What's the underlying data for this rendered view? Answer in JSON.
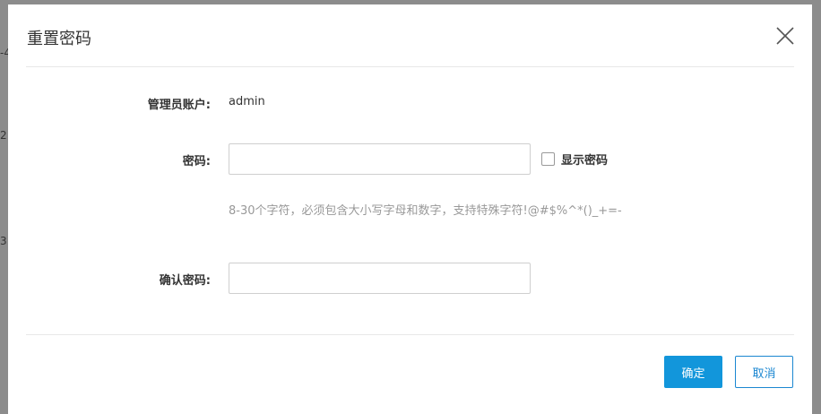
{
  "backdrop": {
    "fragments": [
      "-4",
      "2",
      "3"
    ]
  },
  "dialog": {
    "title": "重置密码",
    "close_icon": "close-icon"
  },
  "form": {
    "account_label": "管理员账户:",
    "account_value": "admin",
    "password_label": "密码:",
    "password_value": "",
    "show_password_label": "显示密码",
    "show_password_checked": false,
    "password_hint": "8-30个字符，必须包含大小写字母和数字，支持特殊字符!@#$%^*()_+=-",
    "confirm_label": "确认密码:",
    "confirm_value": ""
  },
  "footer": {
    "confirm_button": "确定",
    "cancel_button": "取消"
  },
  "colors": {
    "primary": "#1296db",
    "overlay": "#8c8c8c",
    "hint_text": "#999999"
  }
}
